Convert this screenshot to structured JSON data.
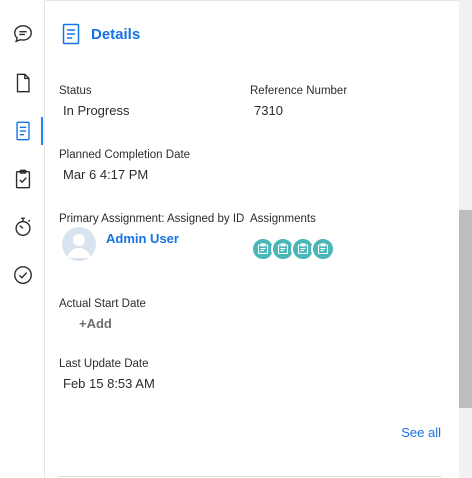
{
  "panel": {
    "title": "Details"
  },
  "fields": {
    "status": {
      "label": "Status",
      "value": "In Progress"
    },
    "reference": {
      "label": "Reference Number",
      "value": "7310"
    },
    "planned": {
      "label": "Planned Completion Date",
      "value": "Mar 6 4:17 PM"
    },
    "primary": {
      "label": "Primary Assignment: Assigned by ID",
      "user": "Admin User"
    },
    "assignments": {
      "label": "Assignments",
      "count": 4
    },
    "actual_start": {
      "label": "Actual Start Date",
      "add": "+Add"
    },
    "last_update": {
      "label": "Last Update Date",
      "value": "Feb 15 8:53 AM"
    }
  },
  "see_all": "See all",
  "colors": {
    "accent": "#1473e6",
    "assignment_badge": "#49b7b8"
  },
  "rail_icons": [
    "comment-icon",
    "document-icon",
    "details-icon",
    "clipboard-check-icon",
    "timer-icon",
    "check-circle-icon"
  ]
}
